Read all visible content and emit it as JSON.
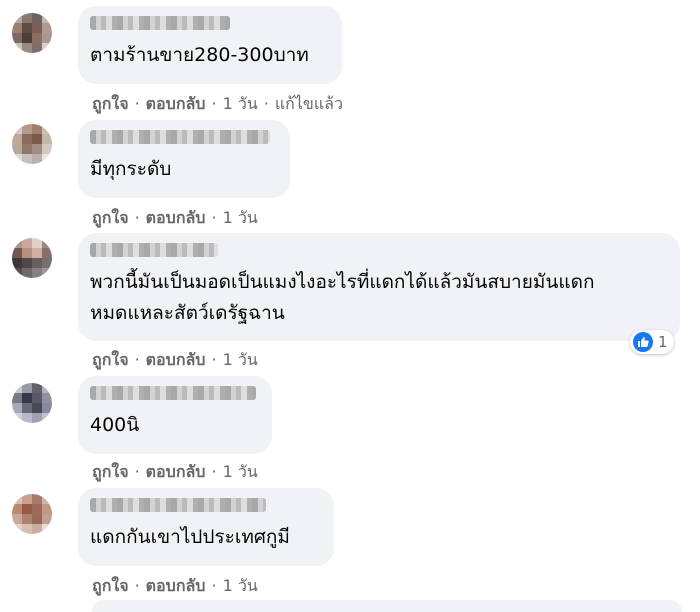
{
  "actions": {
    "like": "ถูกใจ",
    "reply": "ตอบกลับ",
    "dot": "·",
    "edited": "แก้ไขแล้ว"
  },
  "comments": [
    {
      "text": "ตามร้านขาย280-300บาท",
      "time": "1 วัน",
      "edited": true,
      "avatar_colors": [
        "#b8a8a0",
        "#8a7870",
        "#6f6060",
        "#c4b8b0",
        "#9a8070",
        "#5d4b45",
        "#7a5f55",
        "#b09a90",
        "#7e6a62",
        "#4f3d38",
        "#8c6e62",
        "#a89890",
        "#c8beb8",
        "#9a8a84",
        "#7d706c",
        "#d8d0cc"
      ]
    },
    {
      "text": "มีทุกระดับ",
      "time": "1 วัน",
      "edited": false,
      "avatar_colors": [
        "#d8c8c0",
        "#b49a8c",
        "#a08070",
        "#d0c0b8",
        "#c0a898",
        "#8a6a5a",
        "#7a5a4a",
        "#c8b4a8",
        "#b8a89c",
        "#907868",
        "#a08c80",
        "#d4c8c0",
        "#e0d8d4",
        "#c8c0bc",
        "#b8b0ac",
        "#e8e4e0"
      ]
    },
    {
      "text": "พวกนี้มันเป็นมอดเป็นแมงไงอะไรที่แดกได้แล้วมันสบายมันแดก\nหมดแหละสัตว์เดรัฐฉาน",
      "time": "1 วัน",
      "edited": false,
      "reactions": "1",
      "avatar_colors": [
        "#a89890",
        "#c8a8a0",
        "#e0d0c8",
        "#9a8880",
        "#705850",
        "#b89080",
        "#d0b0a0",
        "#887068",
        "#3c3838",
        "#504848",
        "#686060",
        "#787070",
        "#585050",
        "#706868",
        "#888080",
        "#a09898"
      ]
    },
    {
      "text": "400นิ",
      "time": "1 วัน",
      "edited": false,
      "avatar_colors": [
        "#c8c8d0",
        "#9898a8",
        "#606070",
        "#b0b0c0",
        "#787888",
        "#383848",
        "#585868",
        "#9090a0",
        "#a8a8b8",
        "#686878",
        "#484858",
        "#8888a0",
        "#d0d0d8",
        "#b8b8c8",
        "#a0a0b0",
        "#c0c0cc"
      ]
    },
    {
      "text": "แดกกันเขาไปประเทศกูมี",
      "time": "1 วัน",
      "edited": false,
      "avatar_colors": [
        "#d8c0b0",
        "#c8a090",
        "#a87868",
        "#d0b8a8",
        "#b88870",
        "#985848",
        "#a06858",
        "#c09888",
        "#c8a898",
        "#b08070",
        "#986858",
        "#c0a090",
        "#e0d0c8",
        "#d8c0b0",
        "#c8b0a0",
        "#e8dcd4"
      ]
    }
  ]
}
